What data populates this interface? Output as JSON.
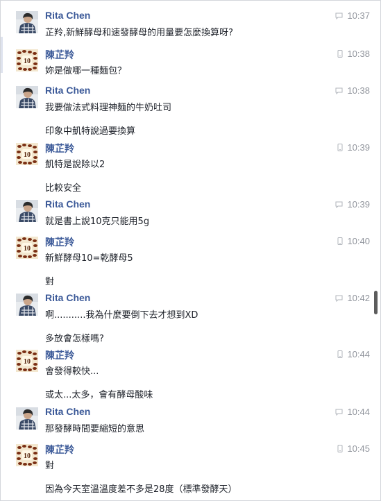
{
  "messages": [
    {
      "sender": "Rita Chen",
      "time": "10:37",
      "lines": [
        "芷羚,新鮮酵母和速發酵母的用量要怎麼換算呀?"
      ]
    },
    {
      "sender": "陳芷羚",
      "time": "10:38",
      "lines": [
        "妳是做哪一種麵包？"
      ]
    },
    {
      "sender": "Rita Chen",
      "time": "10:38",
      "lines": [
        "我要做法式料理神麵的牛奶吐司",
        "印象中凱特說過要換算"
      ]
    },
    {
      "sender": "陳芷羚",
      "time": "10:39",
      "lines": [
        "凱特是說除以2",
        "比較安全"
      ]
    },
    {
      "sender": "Rita Chen",
      "time": "10:39",
      "lines": [
        "就是書上說10克只能用5g"
      ]
    },
    {
      "sender": "陳芷羚",
      "time": "10:40",
      "lines": [
        "新鮮酵母10=乾酵母5",
        "對"
      ]
    },
    {
      "sender": "Rita Chen",
      "time": "10:42",
      "lines": [
        "啊...........我為什麼要倒下去才想到XD",
        "多放會怎樣嗎?"
      ]
    },
    {
      "sender": "陳芷羚",
      "time": "10:44",
      "lines": [
        "會發得較快...",
        "或太...太多，會有酵母酸味"
      ]
    },
    {
      "sender": "Rita Chen",
      "time": "10:44",
      "lines": [
        "那發酵時間要縮短的意思"
      ]
    },
    {
      "sender": "陳芷羚",
      "time": "10:45",
      "lines": [
        "對",
        "因為今天室溫溫度差不多是28度（標準發酵天）"
      ]
    }
  ]
}
